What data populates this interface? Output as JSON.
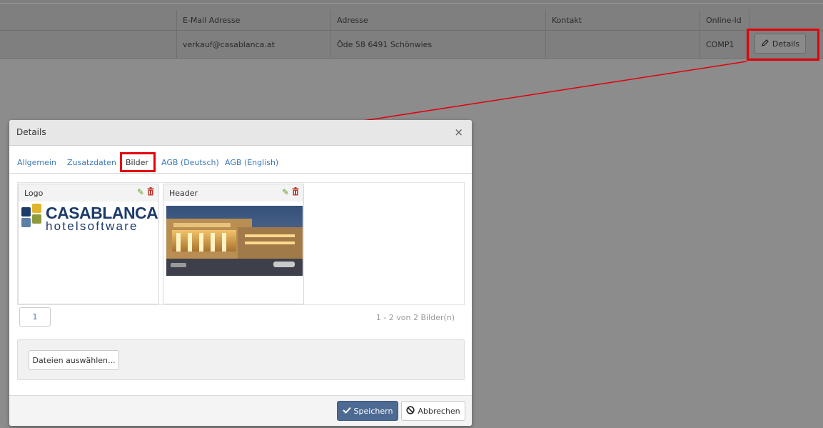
{
  "table": {
    "headers": [
      "E-Mail Adresse",
      "Adresse",
      "Kontakt",
      "Online-Id"
    ],
    "row": {
      "email": "verkauf@casablanca.at",
      "address": "Öde 58 6491 Schönwies",
      "contact": "",
      "online_id": "COMP1",
      "details_label": "Details"
    }
  },
  "dialog": {
    "title": "Details",
    "close_icon": "×",
    "tabs": [
      "Allgemein",
      "Zusatzdaten",
      "Bilder",
      "AGB (Deutsch)",
      "AGB (English)"
    ],
    "active_tab": "Bilder",
    "images": [
      {
        "title": "Logo",
        "logo_brand": "CASABLANCA",
        "logo_sub": "hotelsoftware"
      },
      {
        "title": "Header"
      }
    ],
    "pager": {
      "current_page": "1",
      "info": "1 - 2 von 2 Bilder(n)"
    },
    "upload_label": "Dateien auswählen...",
    "save_label": "Speichern",
    "cancel_label": "Abbrechen"
  },
  "colors": {
    "highlight": "#e3000b",
    "link": "#3a78b7",
    "save_button": "#4d6a93",
    "logo_navy": "#1d3b6a"
  },
  "icons": [
    "pencil-icon",
    "edit-icon",
    "delete-icon",
    "close-icon",
    "check-icon",
    "ban-icon"
  ]
}
